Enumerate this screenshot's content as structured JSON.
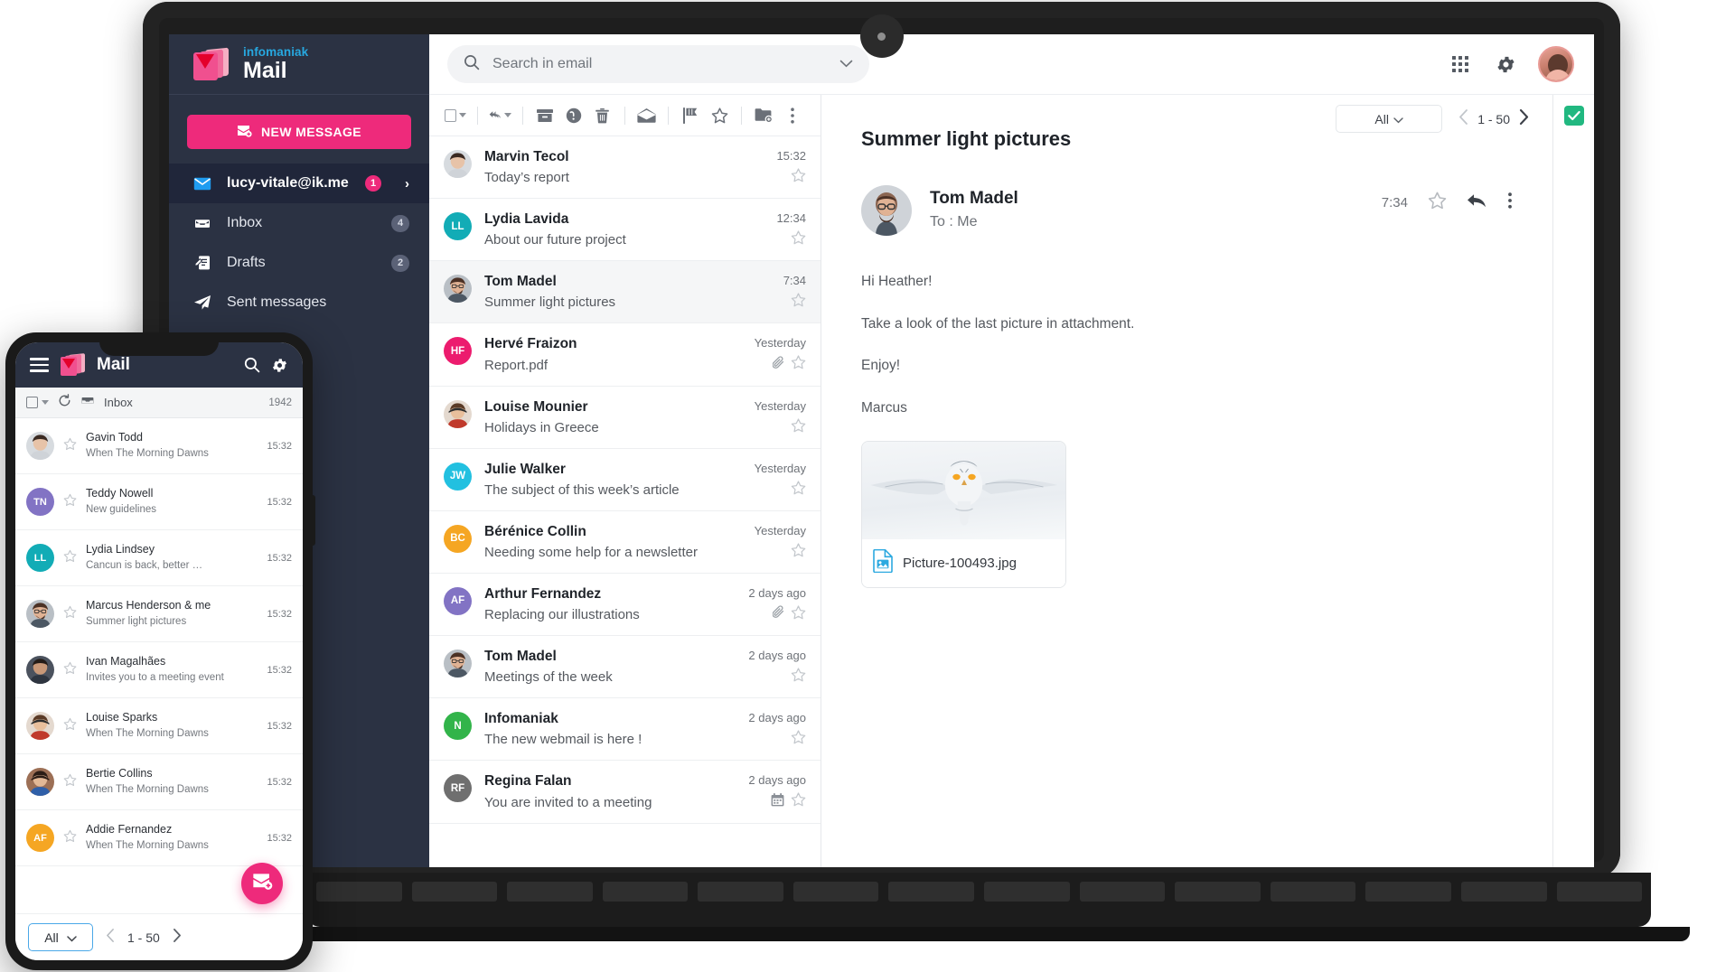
{
  "brand": {
    "sub": "infomaniak",
    "title": "Mail"
  },
  "sidebar": {
    "new_message_label": "NEW MESSAGE",
    "items": [
      {
        "label": "lucy-vitale@ik.me",
        "icon": "envelope-icon",
        "badge": "1",
        "badge_kind": "pink",
        "chevron": "›",
        "active": true
      },
      {
        "label": "Inbox",
        "icon": "inbox-icon",
        "badge": "4",
        "badge_kind": "grey",
        "active": false
      },
      {
        "label": "Drafts",
        "icon": "drafts-icon",
        "badge": "2",
        "badge_kind": "grey",
        "active": false
      },
      {
        "label": "Sent messages",
        "icon": "send-icon",
        "badge": "",
        "badge_kind": "none",
        "active": false
      }
    ]
  },
  "topbar": {
    "search_placeholder": "Search in email",
    "search_icon": "search-icon",
    "search_expand_icon": "chevron-down-icon",
    "apps_icon": "app-grid-icon",
    "settings_icon": "gear-icon",
    "avatar_icon": "user-avatar"
  },
  "list_toolbar": {
    "select_all": "select-all-checkbox",
    "select_all_caret": "chevron-down-icon",
    "reply_all": "reply-all-icon",
    "reply_caret": "chevron-down-icon",
    "archive": "archive-icon",
    "spam": "spam-icon",
    "delete": "trash-icon",
    "mark_read": "open-envelope-icon",
    "flag": "flag-icon",
    "star": "star-icon",
    "move": "move-folder-icon",
    "more": "more-vertical-icon",
    "filter_label": "All",
    "filter_caret": "chevron-down-icon",
    "page_label": "1 - 50",
    "prev_icon": "chevron-left-icon",
    "next_icon": "chevron-right-icon"
  },
  "mail_list": [
    {
      "from": "Marvin Tecol",
      "subject": "Today’s report",
      "time": "15:32",
      "avatar_type": "photo",
      "photo": "man1",
      "initials": "",
      "color": "#b9bec4",
      "attachment": false,
      "calendar": false,
      "selected": false
    },
    {
      "from": "Lydia Lavida",
      "subject": "About our future project",
      "time": "12:34",
      "avatar_type": "initials",
      "photo": "",
      "initials": "LL",
      "color": "#12acb6",
      "attachment": false,
      "calendar": false,
      "selected": false
    },
    {
      "from": "Tom Madel",
      "subject": "Summer light pictures",
      "time": "7:34",
      "avatar_type": "photo",
      "photo": "man2",
      "initials": "",
      "color": "#9aa0a6",
      "attachment": false,
      "calendar": false,
      "selected": true
    },
    {
      "from": "Hervé Fraizon",
      "subject": "Report.pdf",
      "time": "Yesterday",
      "avatar_type": "initials",
      "photo": "",
      "initials": "HF",
      "color": "#ec1c6e",
      "attachment": true,
      "calendar": false,
      "selected": false
    },
    {
      "from": "Louise Mounier",
      "subject": "Holidays in Greece",
      "time": "Yesterday",
      "avatar_type": "photo",
      "photo": "woman1",
      "initials": "",
      "color": "#d9a48f",
      "attachment": false,
      "calendar": false,
      "selected": false
    },
    {
      "from": "Julie Walker",
      "subject": "The subject of this week’s article",
      "time": "Yesterday",
      "avatar_type": "initials",
      "photo": "",
      "initials": "JW",
      "color": "#22c0e0",
      "attachment": false,
      "calendar": false,
      "selected": false
    },
    {
      "from": "Bérénice Collin",
      "subject": "Needing some help for a newsletter",
      "time": "Yesterday",
      "avatar_type": "initials",
      "photo": "",
      "initials": "BC",
      "color": "#f5a623",
      "attachment": false,
      "calendar": false,
      "selected": false
    },
    {
      "from": "Arthur Fernandez",
      "subject": "Replacing our illustrations",
      "time": "2 days ago",
      "avatar_type": "initials",
      "photo": "",
      "initials": "AF",
      "color": "#8273c4",
      "attachment": true,
      "calendar": false,
      "selected": false
    },
    {
      "from": "Tom Madel",
      "subject": "Meetings of the week",
      "time": "2 days ago",
      "avatar_type": "photo",
      "photo": "man2",
      "initials": "",
      "color": "#9aa0a6",
      "attachment": false,
      "calendar": false,
      "selected": false
    },
    {
      "from": "Infomaniak",
      "subject": "The new webmail is here !",
      "time": "2 days ago",
      "avatar_type": "initials",
      "photo": "",
      "initials": "N",
      "color": "#32b44a",
      "attachment": false,
      "calendar": false,
      "selected": false
    },
    {
      "from": "Regina Falan",
      "subject": "You are invited to a meeting",
      "time": "2 days ago",
      "avatar_type": "initials",
      "photo": "",
      "initials": "RF",
      "color": "#6f6f6f",
      "attachment": false,
      "calendar": true,
      "selected": false
    }
  ],
  "detail": {
    "subject": "Summer light pictures",
    "sender": "Tom Madel",
    "to": "To : Me",
    "time": "7:34",
    "star_icon": "star-icon",
    "reply_icon": "reply-icon",
    "more_icon": "more-vertical-icon",
    "body": [
      "Hi Heather!",
      "Take a look of the last picture in attachment.",
      "Enjoy!",
      "Marcus"
    ],
    "attachment": {
      "name": "Picture-100493.jpg",
      "icon": "image-file-icon",
      "preview": "snowy-owl-in-flight"
    }
  },
  "right_rail": {
    "chip_icon": "check-square-icon",
    "chip_color": "#21b880"
  },
  "phone": {
    "menu_icon": "hamburger-menu-icon",
    "title": "Mail",
    "search_icon": "search-icon",
    "settings_icon": "gear-icon",
    "subbar": {
      "checkbox_icon": "select-all-checkbox",
      "caret_icon": "chevron-down-icon",
      "refresh_icon": "refresh-icon",
      "folder_icon": "inbox-icon",
      "folder_label": "Inbox",
      "count": "1942"
    },
    "rows": [
      {
        "from": "Gavin Todd",
        "subject": "When The Morning Dawns",
        "time": "15:32",
        "avatar_type": "photo",
        "photo": "man1",
        "initials": "",
        "color": "#c2c7cc"
      },
      {
        "from": "Teddy Nowell",
        "subject": "New guidelines",
        "time": "15:32",
        "avatar_type": "initials",
        "photo": "",
        "initials": "TN",
        "color": "#8273c4"
      },
      {
        "from": "Lydia Lindsey",
        "subject": "Cancun is back, better …",
        "time": "15:32",
        "avatar_type": "initials",
        "photo": "",
        "initials": "LL",
        "color": "#12acb6"
      },
      {
        "from": "Marcus Henderson & me",
        "subject": "Summer light pictures",
        "time": "15:32",
        "avatar_type": "photo",
        "photo": "man2",
        "initials": "",
        "color": "#9aa0a6"
      },
      {
        "from": "Ivan Magalhães",
        "subject": "Invites you to a meeting event",
        "time": "15:32",
        "avatar_type": "photo",
        "photo": "man3",
        "initials": "",
        "color": "#5a6070"
      },
      {
        "from": "Louise Sparks",
        "subject": "When The Morning Dawns",
        "time": "15:32",
        "avatar_type": "photo",
        "photo": "woman1",
        "initials": "",
        "color": "#d9a48f"
      },
      {
        "from": "Bertie Collins",
        "subject": "When The Morning Dawns",
        "time": "15:32",
        "avatar_type": "photo",
        "photo": "woman2",
        "initials": "",
        "color": "#b08968"
      },
      {
        "from": "Addie Fernandez",
        "subject": "When The Morning Dawns",
        "time": "15:32",
        "avatar_type": "initials",
        "photo": "",
        "initials": "AF",
        "color": "#f5a623"
      }
    ],
    "footer": {
      "filter_label": "All",
      "filter_caret": "chevron-down-icon",
      "prev_icon": "chevron-left-icon",
      "page_label": "1 - 50",
      "next_icon": "chevron-right-icon",
      "fab_icon": "new-message-icon"
    }
  },
  "colors": {
    "accent_pink": "#ee2a7b",
    "sidebar_bg": "#2b3243",
    "sidebar_active": "#20263a",
    "brand_blue": "#27a8e0"
  }
}
